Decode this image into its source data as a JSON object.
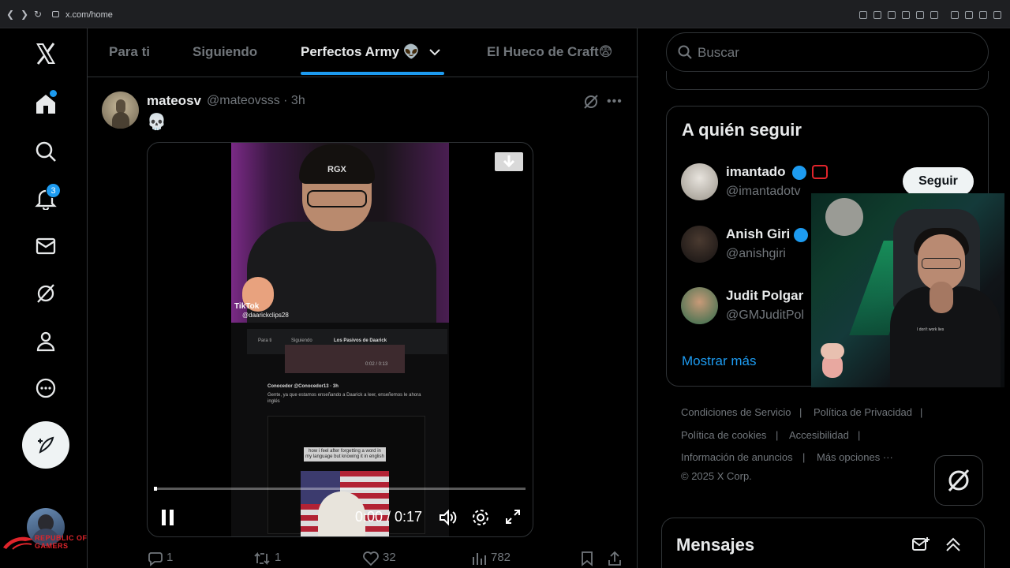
{
  "browser": {
    "url": "x.com/home"
  },
  "nav": {
    "notifications_badge": "3"
  },
  "tabs": [
    {
      "label": "Para ti"
    },
    {
      "label": "Siguiendo"
    },
    {
      "label": "Perfectos Army 👽"
    },
    {
      "label": "El Hueco de Craft😨"
    }
  ],
  "post": {
    "name": "mateosv",
    "handle_time": "@mateovsss · 3h",
    "text": "💀",
    "video": {
      "overlay_channel": "RGX",
      "tiktok_label": "TikTok",
      "tiktok_user": "@daarickclips28",
      "mini_tab_1": "Para ti",
      "mini_tab_2": "Siguiendo",
      "mini_tab_3": "Los Pasivos de Daarick",
      "mini_time": "0:02 / 0:13",
      "mini_post_author": "Conocedor @Conocedor13 · 3h",
      "mini_post_text": "Gente, ya que estamos enseñando a Daarick a leer, enseñemos le  ahora inglés",
      "mini_meme_text": "how i feel after forgetting a word in my language but knowing it in english",
      "time": "0:00 / 0:17",
      "progress": 0.0
    },
    "actions": {
      "replies": "1",
      "reposts": "1",
      "likes": "32",
      "views": "782"
    }
  },
  "search": {
    "placeholder": "Buscar"
  },
  "who_to_follow": {
    "title": "A quién seguir",
    "users": [
      {
        "name": "imantado",
        "handle": "@imantadotv"
      },
      {
        "name": "Anish Giri",
        "handle": "@anishgiri"
      },
      {
        "name": "Judit Polgar",
        "handle": "@GMJuditPol"
      }
    ],
    "follow_label": "Seguir",
    "show_more": "Mostrar más"
  },
  "footer": {
    "links": [
      "Condiciones de Servicio",
      "Política de Privacidad",
      "Política de cookies",
      "Accesibilidad",
      "Información de anuncios",
      "Más opciones ···"
    ],
    "copyright": "© 2025 X Corp."
  },
  "messages": {
    "title": "Mensajes"
  },
  "watermark": {
    "text_line1": "REPUBLIC OF",
    "text_line2": "GAMERS"
  },
  "webcam": {
    "shirt_text": "I don't work lies"
  },
  "colors": {
    "accent": "#1d9bf0",
    "background": "#000000",
    "border": "#2f3336",
    "muted": "#71767b"
  }
}
